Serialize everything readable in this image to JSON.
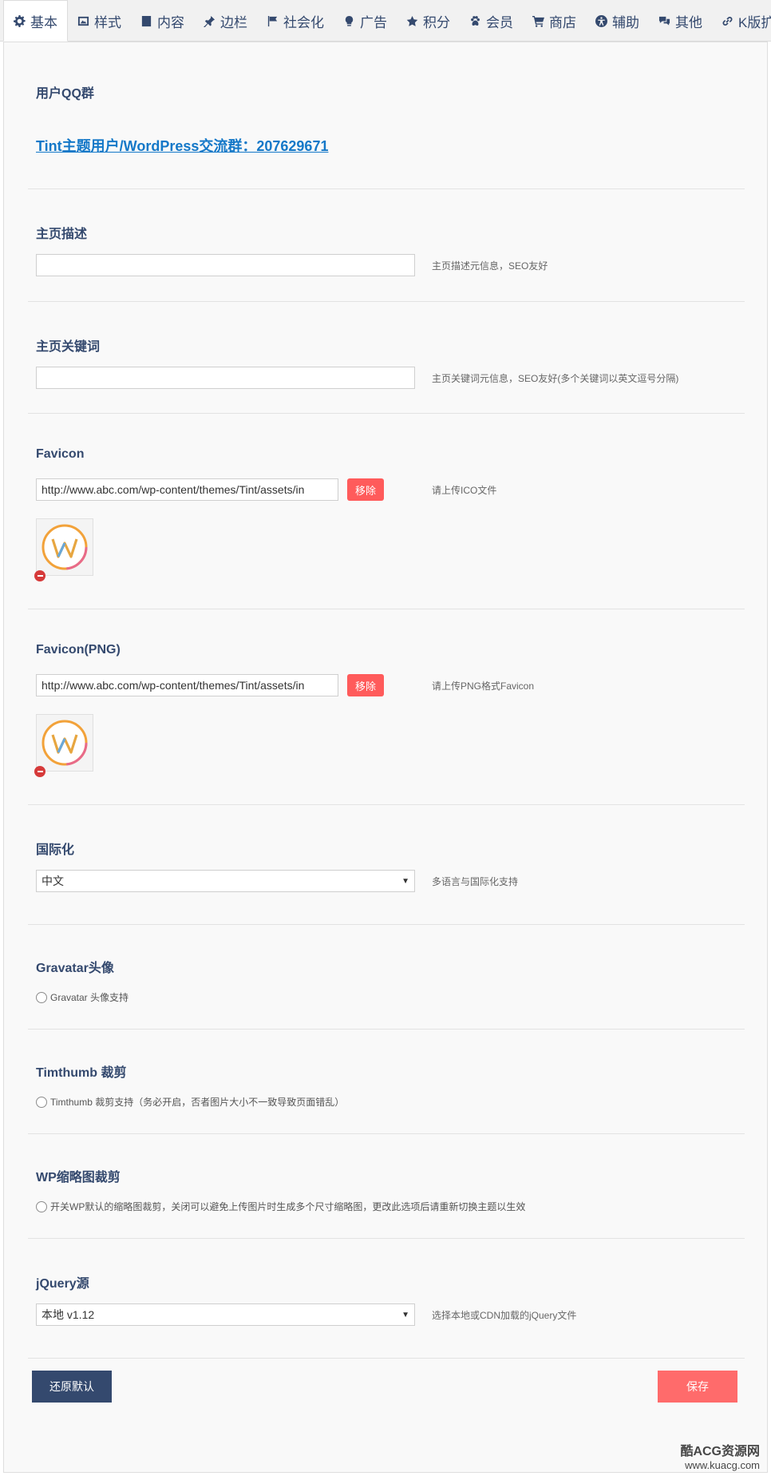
{
  "tabs": [
    {
      "label": "基本",
      "icon": "gear-icon"
    },
    {
      "label": "样式",
      "icon": "image-icon"
    },
    {
      "label": "内容",
      "icon": "document-icon"
    },
    {
      "label": "边栏",
      "icon": "pin-icon"
    },
    {
      "label": "社会化",
      "icon": "flag-icon"
    },
    {
      "label": "广告",
      "icon": "lightbulb-icon"
    },
    {
      "label": "积分",
      "icon": "star-icon"
    },
    {
      "label": "会员",
      "icon": "paw-icon"
    },
    {
      "label": "商店",
      "icon": "cart-icon"
    },
    {
      "label": "辅助",
      "icon": "accessibility-icon"
    },
    {
      "label": "其他",
      "icon": "chat-icon"
    },
    {
      "label": "K版扩展",
      "icon": "link-icon"
    }
  ],
  "sections": {
    "qq_group": {
      "title": "用户QQ群",
      "link": "Tint主题用户/WordPress交流群：207629671"
    },
    "home_desc": {
      "title": "主页描述",
      "value": "",
      "help": "主页描述元信息，SEO友好"
    },
    "home_keywords": {
      "title": "主页关键词",
      "value": "",
      "help": "主页关键词元信息，SEO友好(多个关键词以英文逗号分隔)"
    },
    "favicon": {
      "title": "Favicon",
      "value": "http://www.abc.com/wp-content/themes/Tint/assets/in",
      "remove_label": "移除",
      "help": "请上传ICO文件"
    },
    "favicon_png": {
      "title": "Favicon(PNG)",
      "value": "http://www.abc.com/wp-content/themes/Tint/assets/in",
      "remove_label": "移除",
      "help": "请上传PNG格式Favicon"
    },
    "i18n": {
      "title": "国际化",
      "selected": "中文",
      "help": "多语言与国际化支持"
    },
    "gravatar": {
      "title": "Gravatar头像",
      "option": "Gravatar 头像支持"
    },
    "timthumb": {
      "title": "Timthumb 裁剪",
      "option": "Timthumb 裁剪支持（务必开启，否者图片大小不一致导致页面错乱）"
    },
    "wp_thumb": {
      "title": "WP缩略图裁剪",
      "option": "开关WP默认的缩略图裁剪，关闭可以避免上传图片时生成多个尺寸缩略图，更改此选项后请重新切换主题以生效"
    },
    "jquery": {
      "title": "jQuery源",
      "selected": "本地 v1.12",
      "help": "选择本地或CDN加载的jQuery文件"
    }
  },
  "buttons": {
    "reset": "还原默认",
    "save": "保存"
  },
  "watermark": {
    "line1": "酷ACG资源网",
    "line2": "www.kuacg.com"
  },
  "colors": {
    "accent": "#34496e",
    "danger": "#ff5b5b",
    "link": "#1478c8"
  }
}
